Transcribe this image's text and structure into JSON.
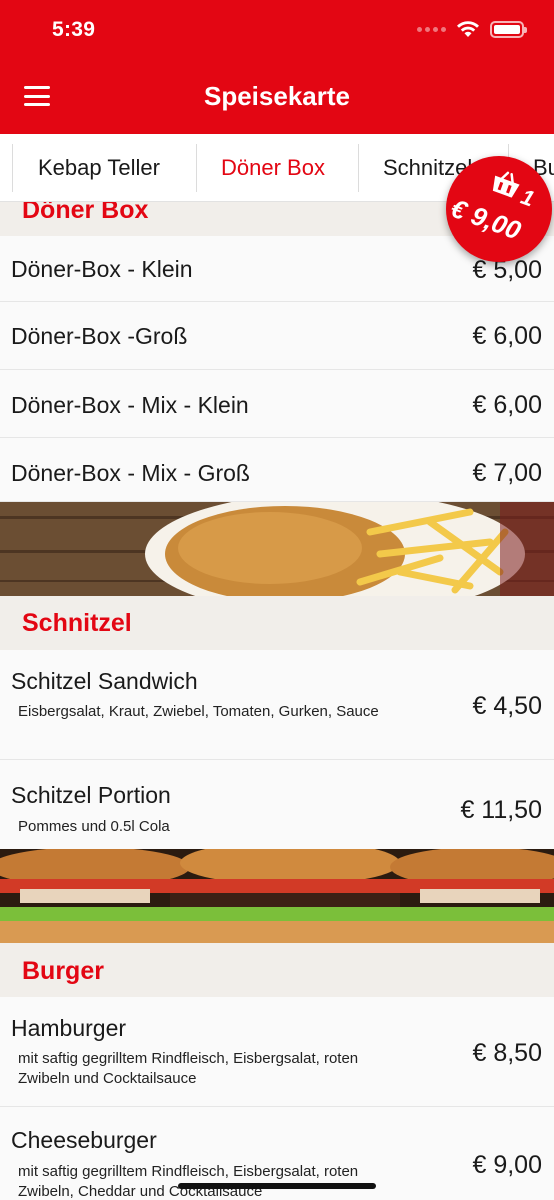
{
  "status_bar": {
    "time": "5:39"
  },
  "header": {
    "title": "Speisekarte",
    "accent_color": "#e30613"
  },
  "tabs": [
    {
      "label": "Kebap Teller",
      "active": false
    },
    {
      "label": "Döner Box",
      "active": true
    },
    {
      "label": "Schnitzel",
      "active": false
    },
    {
      "label": "Burger",
      "active": false
    }
  ],
  "cart": {
    "count": "1",
    "total": "€ 9,00",
    "icon": "shopping-basket-icon"
  },
  "sections": [
    {
      "title": "Döner Box",
      "items": [
        {
          "name": "Döner-Box - Klein",
          "price": "€ 5,00"
        },
        {
          "name": "Döner-Box -Groß",
          "price": "€ 6,00"
        },
        {
          "name": "Döner-Box - Mix - Klein",
          "price": "€ 6,00"
        },
        {
          "name": "Döner-Box - Mix - Groß",
          "price": "€ 7,00"
        }
      ]
    },
    {
      "title": "Schnitzel",
      "image": "schnitzel-fries-photo",
      "items": [
        {
          "name": "Schitzel Sandwich",
          "description": "Eisbergsalat, Kraut, Zwiebel, Tomaten, Gurken, Sauce",
          "price": "€ 4,50"
        },
        {
          "name": "Schitzel Portion",
          "description": "Pommes und 0.5l  Cola",
          "price": "€ 11,50"
        }
      ]
    },
    {
      "title": "Burger",
      "image": "burgers-photo",
      "items": [
        {
          "name": "Hamburger",
          "description": "mit saftig gegrilltem Rindfleisch, Eisbergsalat, roten Zwibeln und Cocktailsauce",
          "price": "€ 8,50"
        },
        {
          "name": "Cheeseburger",
          "description": "mit saftig gegrilltem Rindfleisch, Eisbergsalat, roten Zwibeln, Cheddar und Cocktailsauce",
          "price": "€ 9,00"
        }
      ]
    }
  ]
}
